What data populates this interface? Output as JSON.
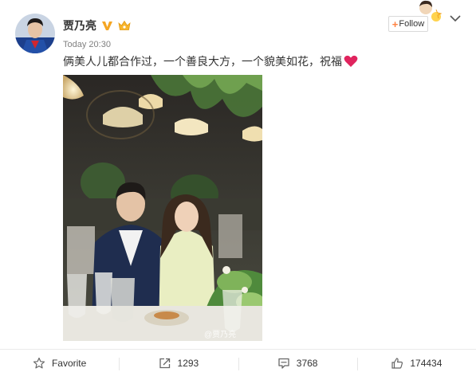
{
  "post": {
    "username": "贾乃亮",
    "timestamp": "Today 20:30",
    "text": "俩美人儿都合作过，一个善良大方，一个貌美如花，祝福",
    "follow_label": "Follow",
    "follow_prefix": "+",
    "watermark": "@贾乃亮",
    "icons": {
      "verified": "verified-v-icon",
      "vip": "vip-crown-icon",
      "heart": "heart-icon",
      "menu": "chevron-down-icon"
    },
    "colors": {
      "verified": "#f5a623",
      "follow_plus": "#ff8140",
      "heart": "#e0245e"
    }
  },
  "actions": {
    "favorite": {
      "label": "Favorite",
      "icon": "star-icon"
    },
    "repost": {
      "count": "1293",
      "icon": "repost-icon"
    },
    "comment": {
      "count": "3768",
      "icon": "comment-icon"
    },
    "like": {
      "count": "174434",
      "icon": "thumbs-up-icon"
    }
  }
}
